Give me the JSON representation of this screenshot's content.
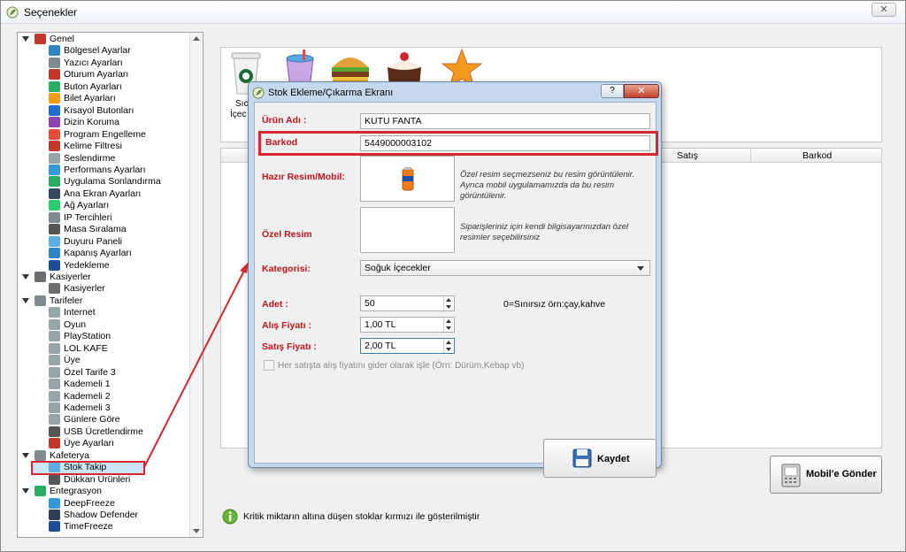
{
  "window": {
    "title": "Seçenekler",
    "close_glyph": "✕"
  },
  "tree": {
    "nodes": [
      {
        "label": "Genel",
        "level": 0,
        "icon": "tools-icon",
        "color": "#c0392b"
      },
      {
        "label": "Bölgesel Ayarlar",
        "level": 1,
        "icon": "globe-icon",
        "color": "#2e86c1"
      },
      {
        "label": "Yazıcı Ayarları",
        "level": 1,
        "icon": "printer-icon",
        "color": "#7f8c8d"
      },
      {
        "label": "Oturum Ayarları",
        "level": 1,
        "icon": "session-icon",
        "color": "#c0392b"
      },
      {
        "label": "Buton Ayarları",
        "level": 1,
        "icon": "button-icon",
        "color": "#27ae60"
      },
      {
        "label": "Bilet Ayarları",
        "level": 1,
        "icon": "ticket-icon",
        "color": "#f39c12"
      },
      {
        "label": "Kısayol Butonları",
        "level": 1,
        "icon": "shortcut-icon",
        "color": "#1f6fd1"
      },
      {
        "label": "Dizin Koruma",
        "level": 1,
        "icon": "folder-icon",
        "color": "#8e44ad"
      },
      {
        "label": "Program Engelleme",
        "level": 1,
        "icon": "block-icon",
        "color": "#e74c3c"
      },
      {
        "label": "Kelime Filtresi",
        "level": 1,
        "icon": "filter-icon",
        "color": "#c0392b"
      },
      {
        "label": "Seslendirme",
        "level": 1,
        "icon": "speaker-icon",
        "color": "#95a5a6"
      },
      {
        "label": "Performans Ayarları",
        "level": 1,
        "icon": "performance-icon",
        "color": "#3498db"
      },
      {
        "label": "Uygulama Sonlandırma",
        "level": 1,
        "icon": "app-close-icon",
        "color": "#27ae60"
      },
      {
        "label": "Ana Ekran Ayarları",
        "level": 1,
        "icon": "monitor-icon",
        "color": "#34495e"
      },
      {
        "label": "Ağ Ayarları",
        "level": 1,
        "icon": "network-icon",
        "color": "#2ecc71"
      },
      {
        "label": "IP Tercihleri",
        "level": 1,
        "icon": "ip-icon",
        "color": "#7f8c8d"
      },
      {
        "label": "Masa Sıralama",
        "level": 1,
        "icon": "grid-icon",
        "color": "#555555"
      },
      {
        "label": "Duyuru Paneli",
        "level": 1,
        "icon": "announce-icon",
        "color": "#5dade2"
      },
      {
        "label": "Kapanış Ayarları",
        "level": 1,
        "icon": "shutdown-icon",
        "color": "#2e86c1"
      },
      {
        "label": "Yedekleme",
        "level": 1,
        "icon": "backup-icon",
        "color": "#1f4e99"
      },
      {
        "label": "Kasiyerler",
        "level": 0,
        "icon": "users-icon",
        "color": "#6d6d6d"
      },
      {
        "label": "Kasiyerler",
        "level": 1,
        "icon": "user-icon",
        "color": "#6d6d6d"
      },
      {
        "label": "Tarifeler",
        "level": 0,
        "icon": "tariff-icon",
        "color": "#7f8c8d"
      },
      {
        "label": "Internet",
        "level": 1,
        "icon": "doc-icon",
        "color": "#95a5a6"
      },
      {
        "label": "Oyun",
        "level": 1,
        "icon": "doc-icon",
        "color": "#95a5a6"
      },
      {
        "label": "PlayStation",
        "level": 1,
        "icon": "doc-icon",
        "color": "#95a5a6"
      },
      {
        "label": "LOL KAFE",
        "level": 1,
        "icon": "doc-icon",
        "color": "#95a5a6"
      },
      {
        "label": "Üye",
        "level": 1,
        "icon": "doc-icon",
        "color": "#95a5a6"
      },
      {
        "label": "Özel Tarife 3",
        "level": 1,
        "icon": "doc-icon",
        "color": "#95a5a6"
      },
      {
        "label": "Kademeli 1",
        "level": 1,
        "icon": "doc-icon",
        "color": "#95a5a6"
      },
      {
        "label": "Kademeli 2",
        "level": 1,
        "icon": "doc-icon",
        "color": "#95a5a6"
      },
      {
        "label": "Kademeli 3",
        "level": 1,
        "icon": "doc-icon",
        "color": "#95a5a6"
      },
      {
        "label": "Günlere Göre",
        "level": 1,
        "icon": "doc-icon",
        "color": "#95a5a6"
      },
      {
        "label": "USB Ücretlendirme",
        "level": 1,
        "icon": "usb-icon",
        "color": "#555555"
      },
      {
        "label": "Üye Ayarları",
        "level": 1,
        "icon": "member-icon",
        "color": "#c0392b"
      },
      {
        "label": "Kafeterya",
        "level": 0,
        "icon": "cafe-icon",
        "color": "#7f8c8d"
      },
      {
        "label": "Stok Takip",
        "level": 1,
        "icon": "stock-icon",
        "color": "#5dade2"
      },
      {
        "label": "Dükkan Ürünleri",
        "level": 1,
        "icon": "shop-icon",
        "color": "#555555"
      },
      {
        "label": "Entegrasyon",
        "level": 0,
        "icon": "integration-icon",
        "color": "#27ae60"
      },
      {
        "label": "DeepFreeze",
        "level": 1,
        "icon": "deepfreeze-icon",
        "color": "#3498db"
      },
      {
        "label": "Shadow Defender",
        "level": 1,
        "icon": "shadow-icon",
        "color": "#2c3e50"
      },
      {
        "label": "TimeFreeze",
        "level": 1,
        "icon": "timefreeze-icon",
        "color": "#1f4e99"
      }
    ]
  },
  "toolbar": {
    "partial_label_1": "Sıc",
    "partial_label_2": "İçec"
  },
  "grid": {
    "columns": [
      "Satış",
      "Barkod"
    ]
  },
  "buttons": {
    "mobile_send": "Mobil'e Gönder"
  },
  "info": {
    "text": "Kritik miktarın altına düşen stoklar kırmızı ile gösterilmiştir"
  },
  "dialog": {
    "title": "Stok Ekleme/Çıkarma Ekranı",
    "help_glyph": "?",
    "close_glyph": "✕",
    "product_name_label": "Ürün Adı :",
    "product_name_value": "KUTU FANTA",
    "barcode_label": "Barkod",
    "barcode_value": "5449000003102",
    "ready_image_label": "Hazır Resim/Mobil:",
    "ready_image_hint": "Özel resim seçmezseniz bu resim görüntülenir. Ayrıca mobil uygulamamızda da bu resim görüntülenir.",
    "custom_image_label": "Özel Resim",
    "custom_image_hint": "Siparişleriniz için kendi bilgisayarınızdan özel resimler seçebilirsiniz",
    "category_label": "Kategorisi:",
    "category_value": "Soğuk İçecekler",
    "qty_label": "Adet :",
    "qty_value": "50",
    "qty_hint": "0=Sınırsız örn:çay,kahve",
    "buy_price_label": "Alış Fiyatı :",
    "buy_price_value": "1,00 TL",
    "sell_price_label": "Satış Fiyatı :",
    "sell_price_value": "2,00 TL",
    "checkbox_label": "Her satışta alış fiyatını gider olarak işle (Örn: Dürüm,Kebap vb)",
    "save_label": "Kaydet"
  },
  "colors": {
    "label_red": "#c0141a",
    "highlight_red": "#d7262c",
    "selection_blue": "#cce4f7"
  }
}
